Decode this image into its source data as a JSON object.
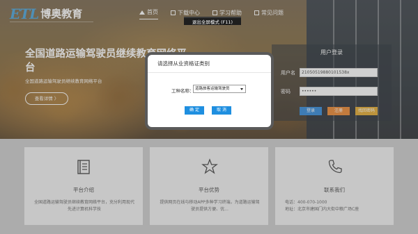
{
  "header": {
    "logo_latin": "ETL",
    "logo_cn": "博奥教育",
    "nav": [
      {
        "label": "首页",
        "icon": "home-icon"
      },
      {
        "label": "下载中心",
        "icon": "download-icon"
      },
      {
        "label": "学习帮助",
        "icon": "help-icon"
      },
      {
        "label": "常见问题",
        "icon": "faq-icon"
      }
    ]
  },
  "fullscreen": {
    "exit_label": "退出全屏模式 (F11)"
  },
  "hero": {
    "title": "全国道路运输驾驶员继续教育网络平台",
    "subtitle": "全国道路运输驾驶员继续教育网络平台",
    "view_details": "查看详情 〉"
  },
  "login": {
    "title": "用户登录",
    "username_label": "用户名",
    "username_value": "21050519880101538x",
    "password_label": "密码",
    "password_value": "••••••",
    "login_button": "登录",
    "register_button": "注册",
    "forgot_button": "找回密码",
    "colors": {
      "login": "#1f7fd6",
      "register": "#e87b1e",
      "forgot": "#e0a11c"
    }
  },
  "modal": {
    "title": "请选择从业资格证类别",
    "field_label": "工种名称：",
    "select_value": "道路旅客运输驾驶员",
    "confirm_button": "确 定",
    "cancel_button": "取 消"
  },
  "cards": [
    {
      "icon": "book-icon",
      "title": "平台介绍",
      "text": "全国道路运输驾驶员继续教育网络平台，充分利用现代先进计算机科学技"
    },
    {
      "icon": "star-icon",
      "title": "平台优势",
      "text": "提供网页在线与移动APP多种学习终端，为道路运输驾驶员提供方便、优..."
    },
    {
      "icon": "phone-icon",
      "title": "联系我们",
      "phone": "电话：400-070-1000",
      "address": "地址：北京市建国门内大街中粮广场C座"
    }
  ]
}
